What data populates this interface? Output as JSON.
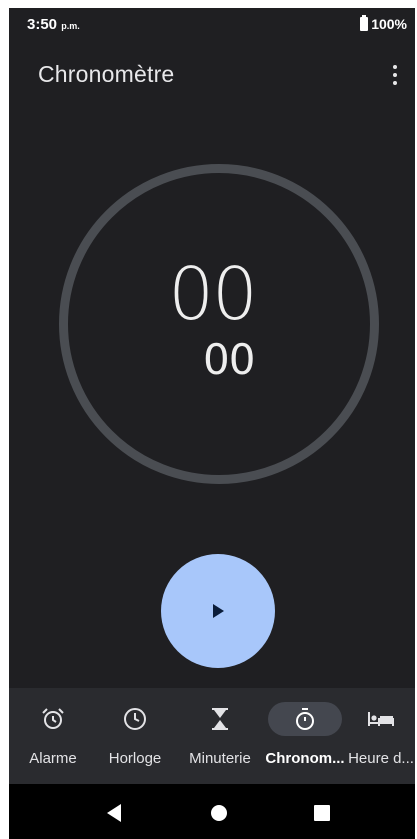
{
  "status_bar": {
    "time": "3:50",
    "time_suffix": "p.m.",
    "battery": "100%"
  },
  "app_bar": {
    "title": "Chronomètre",
    "menu_icon": "more-vert-icon"
  },
  "stopwatch": {
    "seconds": "00",
    "hundredths": "00"
  },
  "controls": {
    "play_icon": "play-icon",
    "color": "#a8c7fa"
  },
  "bottom_nav": {
    "items": [
      {
        "label": "Alarme",
        "icon": "alarm-icon"
      },
      {
        "label": "Horloge",
        "icon": "clock-icon"
      },
      {
        "label": "Minuterie",
        "icon": "hourglass-icon"
      },
      {
        "label": "Chronom...",
        "icon": "stopwatch-icon",
        "active": true
      },
      {
        "label": "Heure d...",
        "icon": "bedtime-icon"
      }
    ]
  },
  "system_nav": {
    "back": "back-icon",
    "home": "home-icon",
    "recents": "recents-icon"
  }
}
